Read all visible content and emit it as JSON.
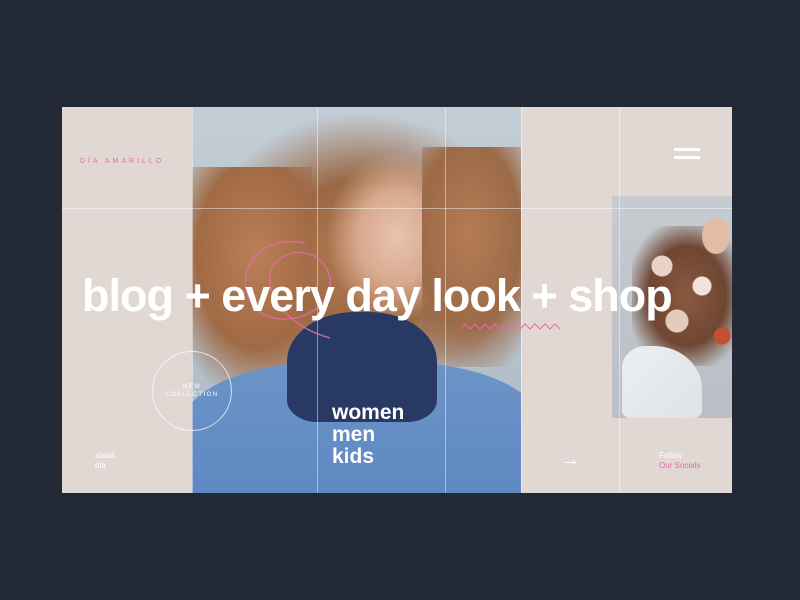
{
  "brand": {
    "name": "DÍA AMARILLO",
    "accent_color": "#e86aa6"
  },
  "menu": {
    "icon": "hamburger-icon"
  },
  "headline": {
    "text": "blog + every day look  + shop"
  },
  "badge": {
    "line1": "NEW",
    "line2": "COLLECTION"
  },
  "about": {
    "line1": "about",
    "line2": "dia"
  },
  "categories": [
    "women",
    "men",
    "kids"
  ],
  "next": {
    "icon": "arrow-right-icon",
    "glyph": "→"
  },
  "follow": {
    "label": "Follow",
    "link": "Our Socials"
  },
  "colors": {
    "background": "#232935",
    "panel": "#e2d8d3",
    "shirt": "#5b86c0"
  }
}
